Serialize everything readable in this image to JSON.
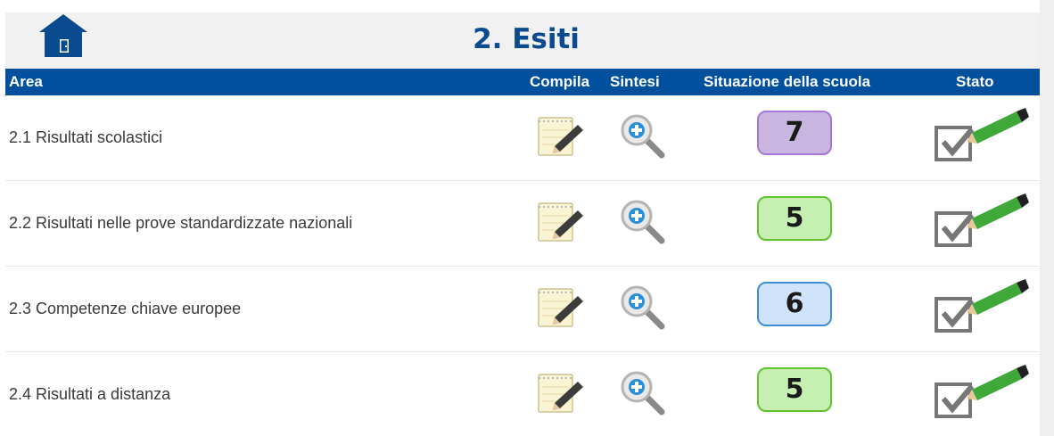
{
  "page": {
    "title": "2. Esiti"
  },
  "header": {
    "area": "Area",
    "compila": "Compila",
    "sintesi": "Sintesi",
    "situazione": "Situazione della scuola",
    "stato": "Stato"
  },
  "icons": {
    "home": "home-icon",
    "compila": "notepad-pencil-icon",
    "sintesi": "magnifier-plus-icon",
    "stato": "checkbox-pencil-icon"
  },
  "rows": [
    {
      "label": "2.1  Risultati scolastici",
      "score": "7",
      "score_bg": "#c9b6e0",
      "score_border": "#a577d6"
    },
    {
      "label": "2.2  Risultati nelle prove standardizzate nazionali",
      "score": "5",
      "score_bg": "#c6f0b2",
      "score_border": "#5fc42e"
    },
    {
      "label": "2.3  Competenze chiave europee",
      "score": "6",
      "score_bg": "#cfe3fb",
      "score_border": "#3f8ed8"
    },
    {
      "label": "2.4  Risultati a distanza",
      "score": "5",
      "score_bg": "#c6f0b2",
      "score_border": "#5fc42e"
    }
  ],
  "colors": {
    "title": "#0a4a8f",
    "header_bg": "#00509d",
    "title_bar_bg": "#f1f1f1"
  }
}
